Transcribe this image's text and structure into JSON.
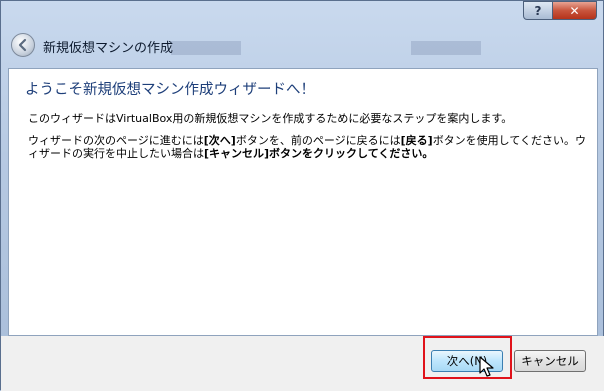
{
  "window": {
    "title": "新規仮想マシンの作成",
    "help_label": "?",
    "close_label": "✕"
  },
  "content": {
    "heading": "ようこそ新規仮想マシン作成ウィザードへ！",
    "paragraph1": "このウィザードはVirtualBox用の新規仮想マシンを作成するために必要なステップを案内します。",
    "paragraph2_part1": "ウィザードの次のページに進むには",
    "paragraph2_bold1": "[次へ]",
    "paragraph2_part2": "ボタンを、前のページに戻るには",
    "paragraph2_bold2": "[戻る]",
    "paragraph2_part3": "ボタンを使用してください。ウィザードの実行を中止したい場合は",
    "paragraph2_bold3": "[キャンセル]ボタンをクリックしてください。"
  },
  "buttons": {
    "next_label": "次へ(N)",
    "cancel_label": "キャンセル"
  },
  "colors": {
    "heading": "#1e3f7a",
    "highlight": "#e0121a"
  }
}
